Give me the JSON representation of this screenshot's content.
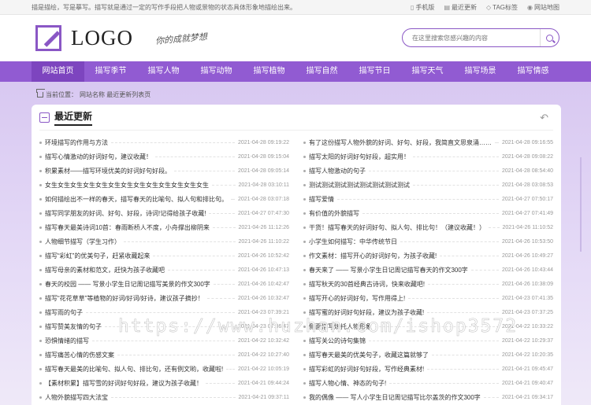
{
  "topbar": {
    "notice": "描是描绘，写是摹写。描写就是通过一定的写作手段把人物或景物的状态具体形象地描绘出来。",
    "links": [
      "手机版",
      "最近更新",
      "TAG标签",
      "网站地图"
    ],
    "link_icons": [
      "phone-icon",
      "clipboard-icon",
      "tag-icon",
      "location-icon"
    ]
  },
  "header": {
    "logo_text": "LOGO",
    "slogan": "你的成就梦想",
    "search_placeholder": "在这里搜索您感兴趣的内容"
  },
  "nav": {
    "items": [
      "网站首页",
      "描写季节",
      "描写人物",
      "描写动物",
      "描写植物",
      "描写自然",
      "描写节日",
      "描写天气",
      "描写场景",
      "描写情感"
    ],
    "active_index": 0
  },
  "breadcrumb": {
    "label": "当前位置：",
    "path": "网站名称 最近更新列表页"
  },
  "panel": {
    "title": "最近更新"
  },
  "articles_left": [
    {
      "title": "环境描写的作用与方法",
      "date": "2021-04-28 09:19:22"
    },
    {
      "title": "描写心情激动的好词好句，建议收藏！",
      "date": "2021-04-28 09:15:04"
    },
    {
      "title": "积累素材——描写环境优美的好词好句好段。",
      "date": "2021-04-28 09:05:14"
    },
    {
      "title": "女生女生女生女生女生女生女生女生女生女生女生女生女生",
      "date": "2021-04-28 03:10:11"
    },
    {
      "title": "如何描绘出不一样的春天，描写春天的比喻句、拟人句和排比句。",
      "date": "2021-04-28 03:07:18"
    },
    {
      "title": "描写同学朋友的好词、好句、好段，诗词!记得给孩子收藏!",
      "date": "2021-04-27 07:47:30"
    },
    {
      "title": "描写春天最美诗词10首：春雨断桥人不度，小舟撑出柳阴来",
      "date": "2021-04-26 11:12:26"
    },
    {
      "title": "人物细节描写（学生习作）",
      "date": "2021-04-26 11:10:22"
    },
    {
      "title": "描写“彩虹”的优美句子，赶紧收藏起来",
      "date": "2021-04-26 10:52:42"
    },
    {
      "title": "描写母亲的素材和范文，赶快为孩子收藏吧",
      "date": "2021-04-26 10:47:13"
    },
    {
      "title": "春天的校园 —— 写景小学生日记周记描写美景的作文300字",
      "date": "2021-04-26 10:42:47"
    },
    {
      "title": "描写“花花草草”等植物的好词/好词/好诗，建议孩子摘抄！",
      "date": "2021-04-26 10:32:47"
    },
    {
      "title": "描写雨的句子",
      "date": "2021-04-23 07:39:21"
    },
    {
      "title": "描写赞美友情的句子",
      "date": "2021-04-23 07:36:47"
    },
    {
      "title": "恐惧情绪的描写",
      "date": "2021-04-22 10:32:42"
    },
    {
      "title": "描写痛苦心情的伤感文案",
      "date": "2021-04-22 10:27:40"
    },
    {
      "title": "描写春天最美的比喻句、拟人句、排比句，还有例文哟，收藏啦!",
      "date": "2021-04-22 10:05:19"
    },
    {
      "title": "【素材积累】描写雪的好词好句好段，建议为孩子收藏！",
      "date": "2021-04-21 09:44:24"
    },
    {
      "title": "人物外貌描写四大法宝",
      "date": "2021-04-21 09:37:11"
    }
  ],
  "articles_right": [
    {
      "title": "有了这份描写人物外貌的好词、好句、好段，我简直文思泉涌……",
      "date": "2021-04-28 09:16:55"
    },
    {
      "title": "描写太阳的好词好句好段，超实用！",
      "date": "2021-04-28 09:08:22"
    },
    {
      "title": "描写人物激动的句子",
      "date": "2021-04-28 08:54:40"
    },
    {
      "title": "测试测试测试测试测试测试测试测试",
      "date": "2021-04-28 03:08:53"
    },
    {
      "title": "描写爱情",
      "date": "2021-04-27 07:50:17"
    },
    {
      "title": "有价值的外貌描写",
      "date": "2021-04-27 07:41:49"
    },
    {
      "title": "干货！描写春天的好词好句、拟人句、排比句！（建议收藏！）",
      "date": "2021-04-26 11:10:52"
    },
    {
      "title": "小学生如何描写：中华传统节日",
      "date": "2021-04-26 10:53:50"
    },
    {
      "title": "作文素材：描写开心的好词好句，为孩子收藏!",
      "date": "2021-04-26 10:49:27"
    },
    {
      "title": "春天来了 —— 写景小学生日记周记描写春天的作文300字",
      "date": "2021-04-26 10:43:44"
    },
    {
      "title": "描写秋天的30首经典古诗词，快来收藏吧!",
      "date": "2021-04-26 10:38:09"
    },
    {
      "title": "描写开心的好词好句，写作用得上!",
      "date": "2021-04-23 07:41:35"
    },
    {
      "title": "描写蜜的好词好句好段，建议为孩子收藏!",
      "date": "2021-04-23 07:37:25"
    },
    {
      "title": "侧面描写烘托人物形象",
      "date": "2021-04-22 10:33:22"
    },
    {
      "title": "描写关公的诗句集锦",
      "date": "2021-04-22 10:29:37"
    },
    {
      "title": "描写春天最美的优美句子，收藏这篇就够了",
      "date": "2021-04-22 10:20:35"
    },
    {
      "title": "描写彩虹的好词好句好段，写作经典素材!",
      "date": "2021-04-21 09:45:47"
    },
    {
      "title": "描写人物心情、神态的句子!",
      "date": "2021-04-21 09:40:47"
    },
    {
      "title": "我的偶像 —— 写人小学生日记周记描写比尔盖茨的作文300字",
      "date": "2021-04-21 09:34:17"
    }
  ],
  "watermark": "https://www.huzhan.com/ishop3572"
}
